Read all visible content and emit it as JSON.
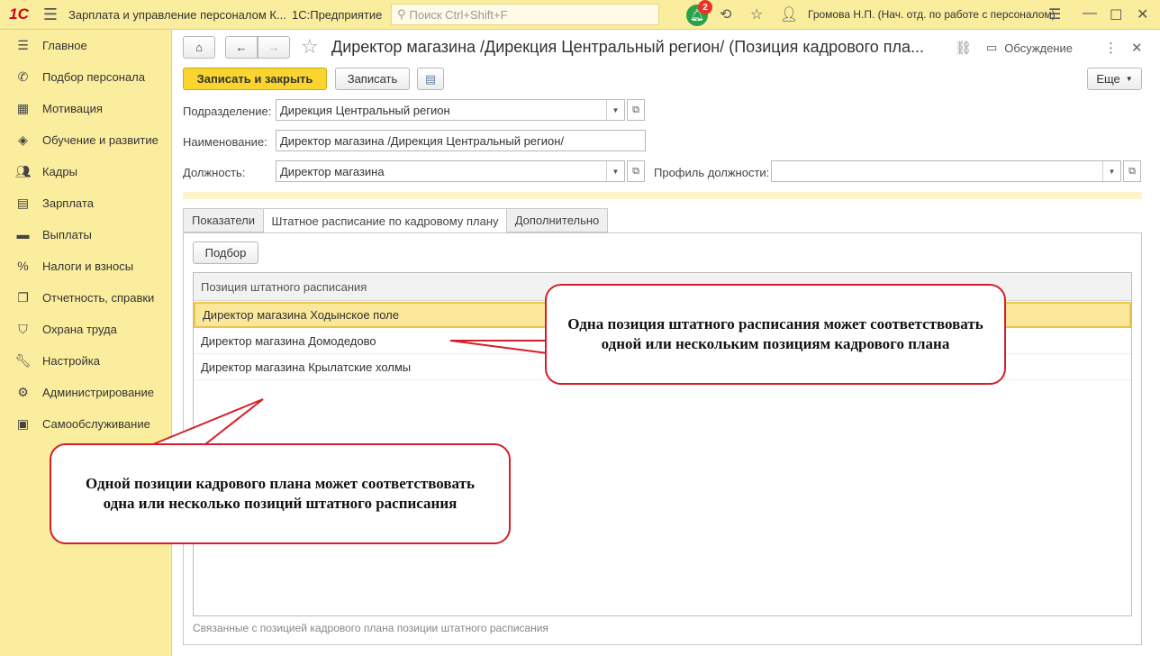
{
  "topbar": {
    "logo": "1С",
    "app_title": "Зарплата и управление персоналом К...",
    "platform": "1С:Предприятие",
    "search_placeholder": "Поиск Ctrl+Shift+F",
    "notifications_count": "2",
    "user": "Громова Н.П. (Нач. отд. по работе с персоналом)"
  },
  "sidebar": {
    "items": [
      {
        "label": "Главное",
        "icon": "menu-icon"
      },
      {
        "label": "Подбор персонала",
        "icon": "phone-icon"
      },
      {
        "label": "Мотивация",
        "icon": "gift-icon"
      },
      {
        "label": "Обучение и развитие",
        "icon": "graduation-cap-icon"
      },
      {
        "label": "Кадры",
        "icon": "people-icon"
      },
      {
        "label": "Зарплата",
        "icon": "calculator-icon"
      },
      {
        "label": "Выплаты",
        "icon": "wallet-icon"
      },
      {
        "label": "Налоги и взносы",
        "icon": "percent-icon"
      },
      {
        "label": "Отчетность, справки",
        "icon": "reports-icon"
      },
      {
        "label": "Охрана труда",
        "icon": "shield-icon"
      },
      {
        "label": "Настройка",
        "icon": "wrench-icon"
      },
      {
        "label": "Администрирование",
        "icon": "gear-icon"
      },
      {
        "label": "Самообслуживание",
        "icon": "id-card-icon"
      }
    ]
  },
  "form": {
    "title": "Директор магазина /Дирекция Центральный регион/ (Позиция кадрового пла...",
    "discussion_label": "Обсуждение",
    "save_close_label": "Записать и закрыть",
    "save_label": "Записать",
    "more_label": "Еще",
    "fields": {
      "subdivision_label": "Подразделение:",
      "subdivision_value": "Дирекция Центральный регион",
      "name_label": "Наименование:",
      "name_value": "Директор магазина /Дирекция Центральный регион/",
      "position_label": "Должность:",
      "position_value": "Директор магазина",
      "profile_label": "Профиль должности:",
      "profile_value": ""
    },
    "tabs": [
      "Показатели",
      "Штатное расписание по кадровому плану",
      "Дополнительно"
    ],
    "select_button": "Подбор",
    "table": {
      "header": "Позиция штатного расписания",
      "rows": [
        "Директор магазина Ходынское поле",
        "Директор магазина Домодедово",
        "Директор магазина Крылатские холмы"
      ]
    },
    "caption": "Связанные с позицией кадрового плана позиции штатного расписания"
  },
  "callouts": {
    "top": "Одна позиция штатного расписания может соответствовать одной или нескольким позициям кадрового плана",
    "bottom": "Одной позиции кадрового плана может соответствовать одна или несколько позиций штатного расписания"
  },
  "colors": {
    "sidebar_bg": "#fbed9e",
    "primary_button": "#fad52f",
    "selected_row": "#fbe79a",
    "callout_border": "#d41f2a",
    "notification": "#2aa24a"
  }
}
